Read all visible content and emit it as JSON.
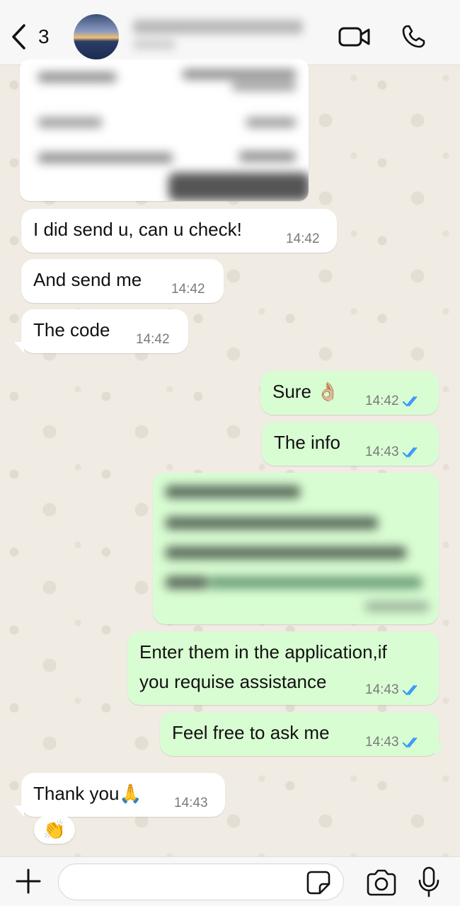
{
  "header": {
    "back_count": "3",
    "contact_name_blurred": "",
    "icons": [
      "chevron-left-icon",
      "video-call-icon",
      "phone-call-icon"
    ]
  },
  "messages": [
    {
      "dir": "in",
      "text": "I did send u, can u check!",
      "time": "14:42"
    },
    {
      "dir": "in",
      "text": "And send me",
      "time": "14:42"
    },
    {
      "dir": "in",
      "text": "The code",
      "time": "14:42"
    },
    {
      "dir": "out",
      "text": "Sure 👌🏼",
      "time": "14:42",
      "status": "read"
    },
    {
      "dir": "out",
      "text": "The info",
      "time": "14:43",
      "status": "read"
    },
    {
      "dir": "out",
      "text": "Enter them in the application,if",
      "text2": "you requise assistance",
      "time": "14:43",
      "status": "read"
    },
    {
      "dir": "out",
      "text": "Feel free to ask me",
      "time": "14:43",
      "status": "read"
    },
    {
      "dir": "in",
      "text": "Thank you🙏",
      "time": "14:43",
      "reaction": "👏"
    }
  ],
  "composer": {
    "placeholder": "",
    "icons": [
      "plus-icon",
      "sticker-icon",
      "camera-icon",
      "microphone-icon"
    ]
  },
  "colors": {
    "incoming_bubble": "#ffffff",
    "outgoing_bubble": "#d9fdd3",
    "read_ticks": "#3497f9",
    "wallpaper": "#efeae2"
  }
}
